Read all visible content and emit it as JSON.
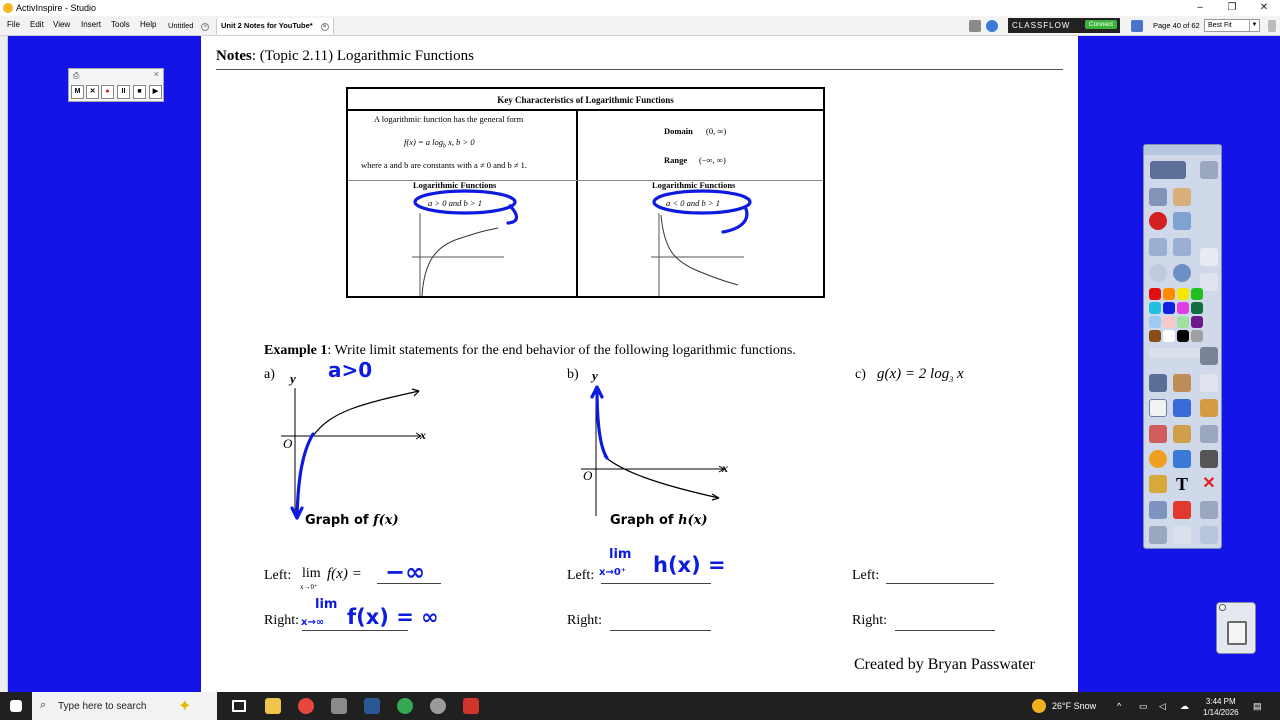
{
  "window": {
    "title": "ActivInspire - Studio",
    "controls": [
      "–",
      "❐",
      "✕"
    ]
  },
  "menu": {
    "items": [
      "File",
      "Edit",
      "View",
      "Insert",
      "Tools",
      "Help"
    ],
    "tabs": [
      "Untitled",
      "Unit 2 Notes for YouTube*"
    ],
    "classflow_label": "CLASSFLOW",
    "connect_label": "Connect",
    "page_info": "Page 40 of 62",
    "zoom": "Best Fit"
  },
  "recorder": {
    "buttons": [
      "M",
      "✕",
      "●",
      "II",
      "■",
      "▶"
    ]
  },
  "page": {
    "title_bold": "Notes",
    "title_rest": ": (Topic 2.11)  Logarithmic Functions",
    "table": {
      "header": "Key Characteristics of Logarithmic Functions",
      "general_form_intro": "A logarithmic function has the general form",
      "general_form": "f(x) = a log",
      "general_form_sub": "b",
      "general_form_tail": " x,     b > 0",
      "constants_note": "where a and b are constants with a ≠ 0 and b ≠ 1.",
      "domain_label": "Domain",
      "domain_value": "(0, ∞)",
      "range_label": "Range",
      "range_value": "(−∞, ∞)",
      "left_graph_title": "Logarithmic Functions",
      "left_graph_condition": "a > 0 and b > 1",
      "right_graph_title": "Logarithmic Functions",
      "right_graph_condition": "a < 0 and b > 1"
    },
    "example": {
      "title_bold": "Example 1",
      "title_rest": ":  Write limit statements for the end behavior of the following logarithmic functions.",
      "part_a": "a)",
      "part_b": "b)",
      "part_c": "c)",
      "part_c_func": "g(x) = 2 log",
      "part_c_sub": "3",
      "part_c_tail": " x",
      "graph_a_caption": "Graph of ",
      "graph_a_func": "f(x)",
      "graph_b_caption": "Graph of ",
      "graph_b_func": "h(x)",
      "axis_y": "y",
      "axis_x": "x",
      "origin": "O"
    },
    "answers": {
      "left_label": "Left:",
      "right_label": "Right:",
      "a_left_lim": "lim",
      "a_left_sub": "x→0⁺",
      "a_left_expr": "f(x) ="
    },
    "handwriting": {
      "a_condition": "a>0",
      "a_left_answer": "−∞",
      "a_right_lim": "lim",
      "a_right_sub": "x→∞",
      "a_right_expr": "f(x) = ∞",
      "b_left_lim": "lim",
      "b_left_sub": "x→0⁺",
      "b_left_expr": "h(x) ="
    },
    "credit": "Created by Bryan Passwater"
  },
  "taskbar": {
    "search_placeholder": "Type here to search",
    "weather": "26°F  Snow",
    "time": "3:44 PM",
    "date": "1/14/2026"
  },
  "colors": {
    "background": "#1414e8",
    "ink": "#0d1be0"
  }
}
